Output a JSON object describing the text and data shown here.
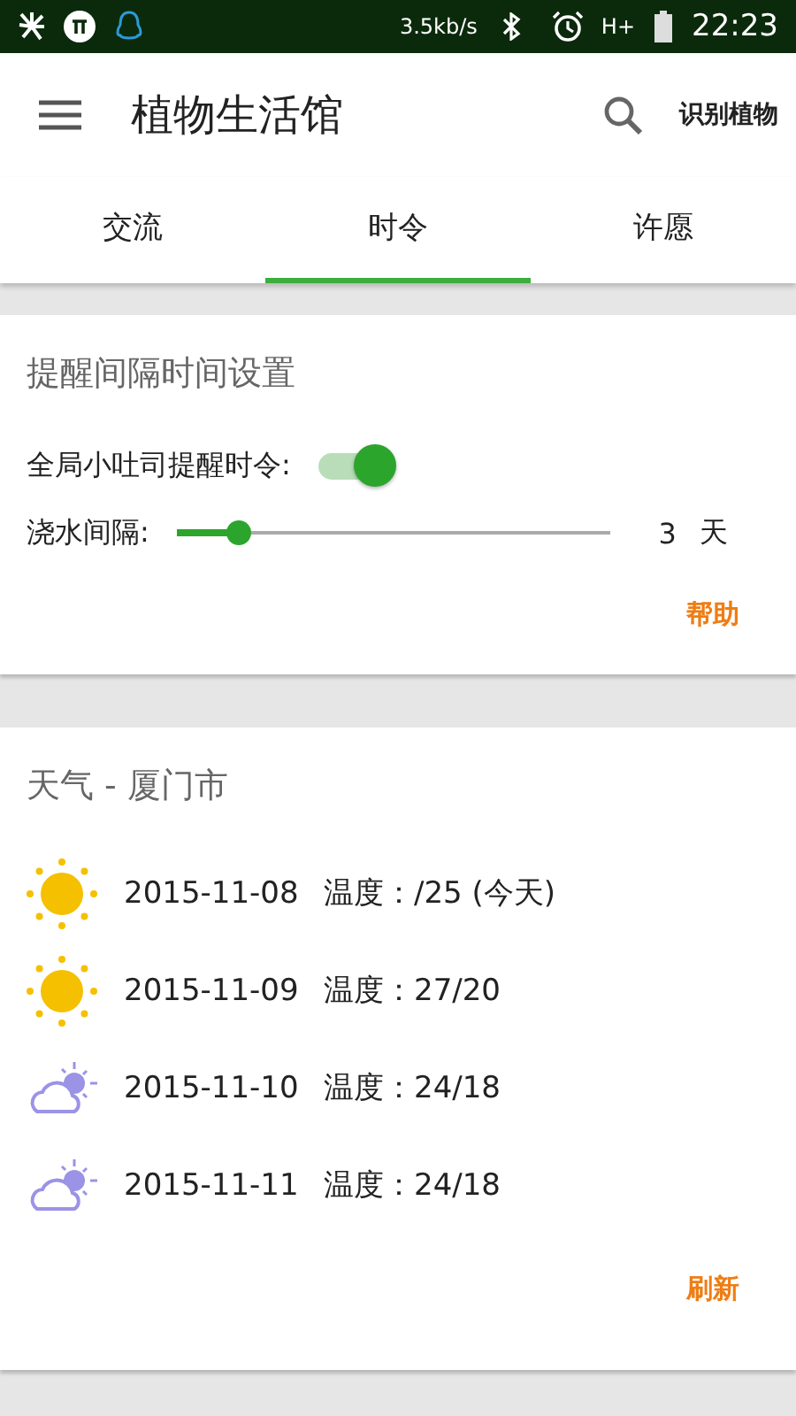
{
  "status_bar": {
    "speed": "3.5kb/s",
    "network": "H+",
    "time": "22:23"
  },
  "app_bar": {
    "title": "植物生活馆",
    "action": "识别植物"
  },
  "tabs": [
    {
      "label": "交流",
      "selected": false
    },
    {
      "label": "时令",
      "selected": true
    },
    {
      "label": "许愿",
      "selected": false
    }
  ],
  "reminder_card": {
    "title": "提醒间隔时间设置",
    "toggle": {
      "label": "全局小吐司提醒时令:",
      "on": true
    },
    "slider": {
      "label": "浇水间隔:",
      "level": 0.14,
      "value": "3",
      "unit": "天"
    },
    "action": "帮助"
  },
  "weather_card": {
    "title": "天气 - 厦门市",
    "days": [
      {
        "kind": "sunny",
        "date": "2015-11-08",
        "temperature": "温度：/25 (今天)"
      },
      {
        "kind": "sunny",
        "date": "2015-11-09",
        "temperature": "温度：27/20"
      },
      {
        "kind": "partly-cloudy",
        "date": "2015-11-10",
        "temperature": "温度：24/18"
      },
      {
        "kind": "partly-cloudy",
        "date": "2015-11-11",
        "temperature": "温度：24/18"
      }
    ],
    "action": "刷新"
  }
}
